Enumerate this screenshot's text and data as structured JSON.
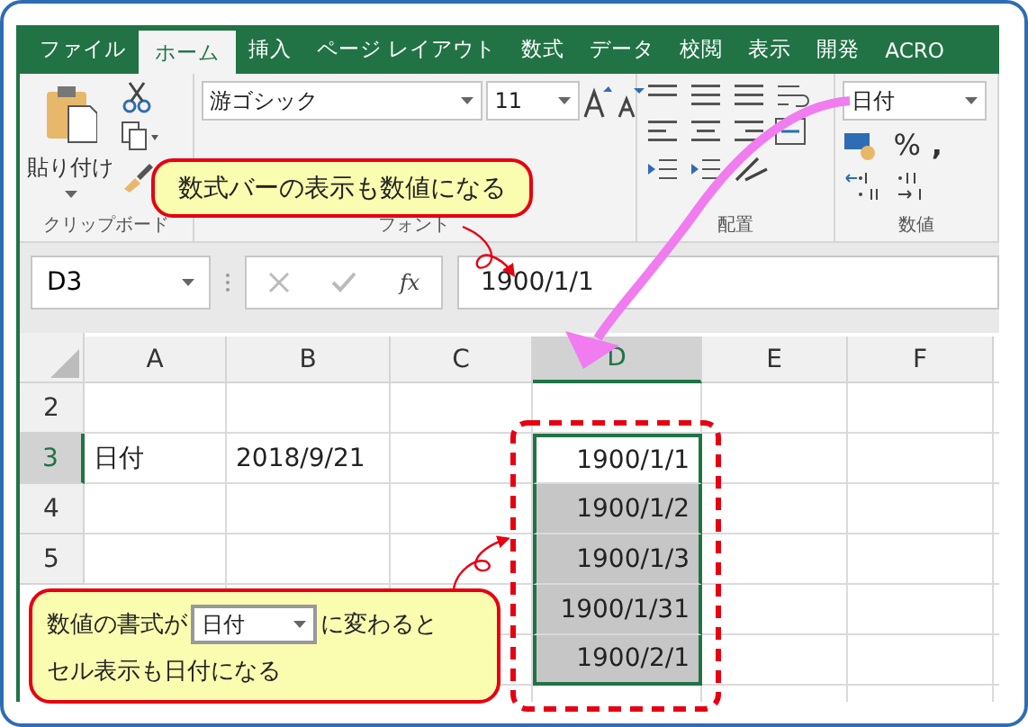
{
  "ribbon_tabs": [
    {
      "label": "ファイル",
      "selected": false
    },
    {
      "label": "ホーム",
      "selected": true
    },
    {
      "label": "挿入",
      "selected": false
    },
    {
      "label": "ページ レイアウト",
      "selected": false
    },
    {
      "label": "数式",
      "selected": false
    },
    {
      "label": "データ",
      "selected": false
    },
    {
      "label": "校閲",
      "selected": false
    },
    {
      "label": "表示",
      "selected": false
    },
    {
      "label": "開発",
      "selected": false
    },
    {
      "label": "ACRO",
      "selected": false
    }
  ],
  "ribbon": {
    "paste_label": "貼り付け",
    "font_name": "游ゴシック",
    "font_size": "11",
    "number_format": "日付",
    "percent": "%",
    "comma": ",",
    "groups": [
      "クリップボード",
      "フォント",
      "配置",
      "数値"
    ]
  },
  "formula_bar": {
    "name_box": "D3",
    "fx": "fx",
    "formula": "1900/1/1"
  },
  "columns": [
    {
      "label": "A",
      "selected": false
    },
    {
      "label": "B",
      "selected": false
    },
    {
      "label": "C",
      "selected": false
    },
    {
      "label": "D",
      "selected": true
    },
    {
      "label": "E",
      "selected": false
    },
    {
      "label": "F",
      "selected": false
    }
  ],
  "rows": [
    {
      "header": "2"
    },
    {
      "header": "3",
      "a": "日付",
      "b": "2018/9/21",
      "d": "1900/1/1",
      "d_selected": true,
      "d_active": true
    },
    {
      "header": "4",
      "d": "1900/1/2",
      "d_selected": true,
      "d_active": false
    },
    {
      "header": "5",
      "d": "1900/1/3",
      "d_selected": true,
      "d_active": false
    },
    {
      "d": "1900/1/31",
      "d_selected": true,
      "d_active": false
    },
    {
      "d": "1900/2/1",
      "d_selected": true,
      "d_active": false
    }
  ],
  "callouts": {
    "formula_note": "数式バーの表示も数値になる",
    "format_note": {
      "before": "数値の書式が",
      "dropdown": "日付",
      "after": "に変わると",
      "line2": "セル表示も日付になる"
    }
  }
}
